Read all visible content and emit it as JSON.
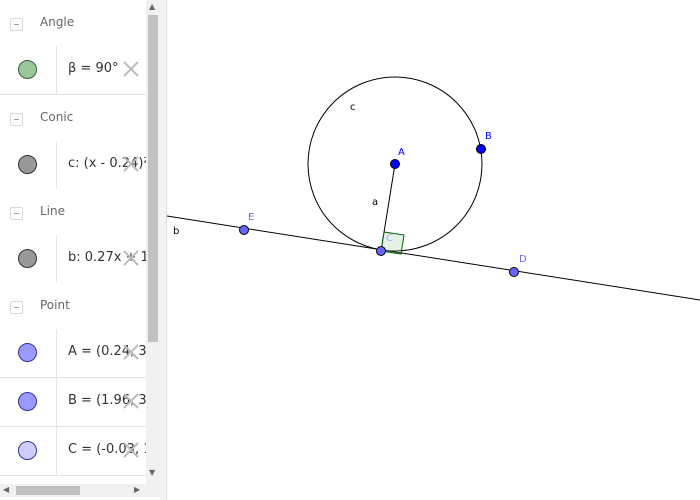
{
  "colors": {
    "angle_fill": "#99c799",
    "conic_fill": "#999999",
    "line_fill": "#999999",
    "point_fill": "#9999ff",
    "point_c_fill": "#ccccff",
    "free_point": "#0000ff",
    "dependent_point": "#6666ff"
  },
  "algebra": {
    "groups": [
      {
        "header": "Angle",
        "items": [
          {
            "definition": "β = 90°",
            "marker": "angle-marker"
          }
        ]
      },
      {
        "header": "Conic",
        "items": [
          {
            "definition": "c: (x - 0.24)²",
            "marker": "conic-marker"
          }
        ]
      },
      {
        "header": "Line",
        "items": [
          {
            "definition": "b: 0.27x + 1.",
            "marker": "line-marker"
          }
        ]
      },
      {
        "header": "Point",
        "items": [
          {
            "definition": "A = (0.24, 3.",
            "marker": "point-marker"
          },
          {
            "definition": "B = (1.96, 3.",
            "marker": "point-marker"
          },
          {
            "definition": "C = (-0.03, 1",
            "marker": "point-marker"
          }
        ]
      }
    ]
  },
  "graphics": {
    "labels": {
      "circle": "c",
      "line": "b",
      "segment": "a",
      "point_a": "A",
      "point_b": "B",
      "point_c": "C",
      "point_d": "D",
      "point_e": "E"
    }
  }
}
